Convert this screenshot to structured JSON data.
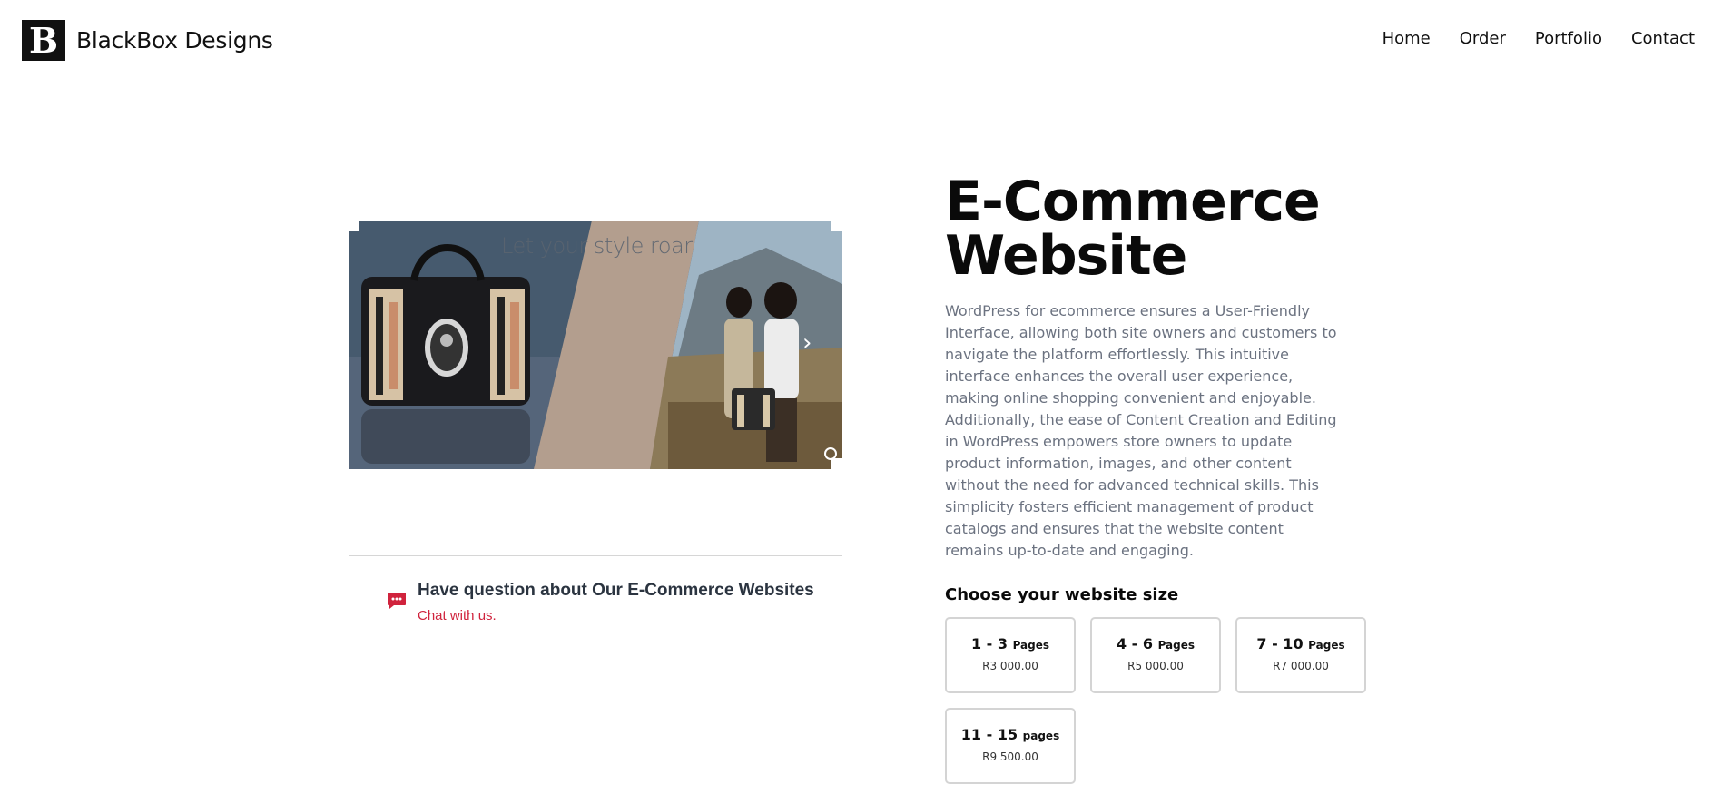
{
  "brand": {
    "logo_letter": "B",
    "name": "BlackBox Designs"
  },
  "nav": {
    "items": [
      "Home",
      "Order",
      "Portfolio",
      "Contact"
    ]
  },
  "slider": {
    "caption": "Let your style roar",
    "next_icon": "chevron-right-icon",
    "zoom_icon": "zoom-icon"
  },
  "question": {
    "title": "Have question about Our E-Commerce Websites",
    "link": "Chat with us.",
    "icon": "chat-bubble-icon",
    "icon_color": "#d0233d"
  },
  "product": {
    "title_line1": "E-Commerce",
    "title_line2": "Website",
    "description_1": "WordPress for ecommerce ensures a User-Friendly Interface, allowing both site owners and customers to navigate the platform effortlessly. This intuitive interface enhances the overall user experience, making online shopping convenient and enjoyable.",
    "description_2": "Additionally, the ease of Content Creation and Editing in WordPress empowers store owners to update product information, images, and other content without the need for advanced technical skills. This simplicity fosters efficient management of product catalogs and ensures that the website content remains up-to-date and engaging.",
    "size_heading": "Choose your website size",
    "sizes": [
      {
        "range": "1 - 3",
        "unit": "Pages",
        "price": "R3 000.00"
      },
      {
        "range": "4 - 6",
        "unit": "Pages",
        "price": "R5 000.00"
      },
      {
        "range": "7 - 10",
        "unit": "Pages",
        "price": "R7 000.00"
      },
      {
        "range": "11 - 15",
        "unit": "pages",
        "price": "R9 500.00"
      }
    ]
  }
}
